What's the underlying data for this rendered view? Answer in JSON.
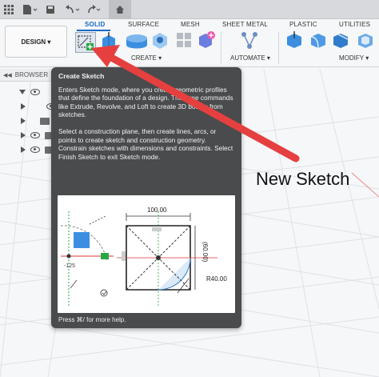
{
  "ribbon": {
    "tabs": [
      {
        "label": "SOLID",
        "active": true
      },
      {
        "label": "SURFACE",
        "active": false
      },
      {
        "label": "MESH",
        "active": false
      },
      {
        "label": "SHEET METAL",
        "active": false
      },
      {
        "label": "PLASTIC",
        "active": false
      },
      {
        "label": "UTILITIES",
        "active": false
      }
    ],
    "workspace_button": "DESIGN ▾",
    "groups": {
      "create": "CREATE ▾",
      "automate": "AUTOMATE ▾",
      "modify": "MODIFY ▾"
    }
  },
  "browser": {
    "title": "BROWSER"
  },
  "tooltip": {
    "title": "Create Sketch",
    "para1": "Enters Sketch mode, where you create geometric profiles that define the foundation of a design. Then use commands like Extrude, Revolve, and Loft to create 3D bodies from sketches.",
    "para2": "Select a construction plane, then create lines, arcs, or points to create sketch and construction geometry. Constrain sketches with dimensions and constraints. Select Finish Sketch to exit Sketch mode.",
    "footer": "Press ⌘/ for more help.",
    "image": {
      "dim_width": "100.00",
      "dim_height": "(60.00)",
      "dim_radius": "R40.00",
      "dim_side": "-125"
    }
  },
  "annotation": {
    "text": "New Sketch",
    "arrow_color": "#e5403f"
  },
  "colors": {
    "accent": "#1769c4",
    "tooltip_bg": "#4a4b4d",
    "arrow": "#e5403f",
    "sketch_green": "#2aa745"
  }
}
